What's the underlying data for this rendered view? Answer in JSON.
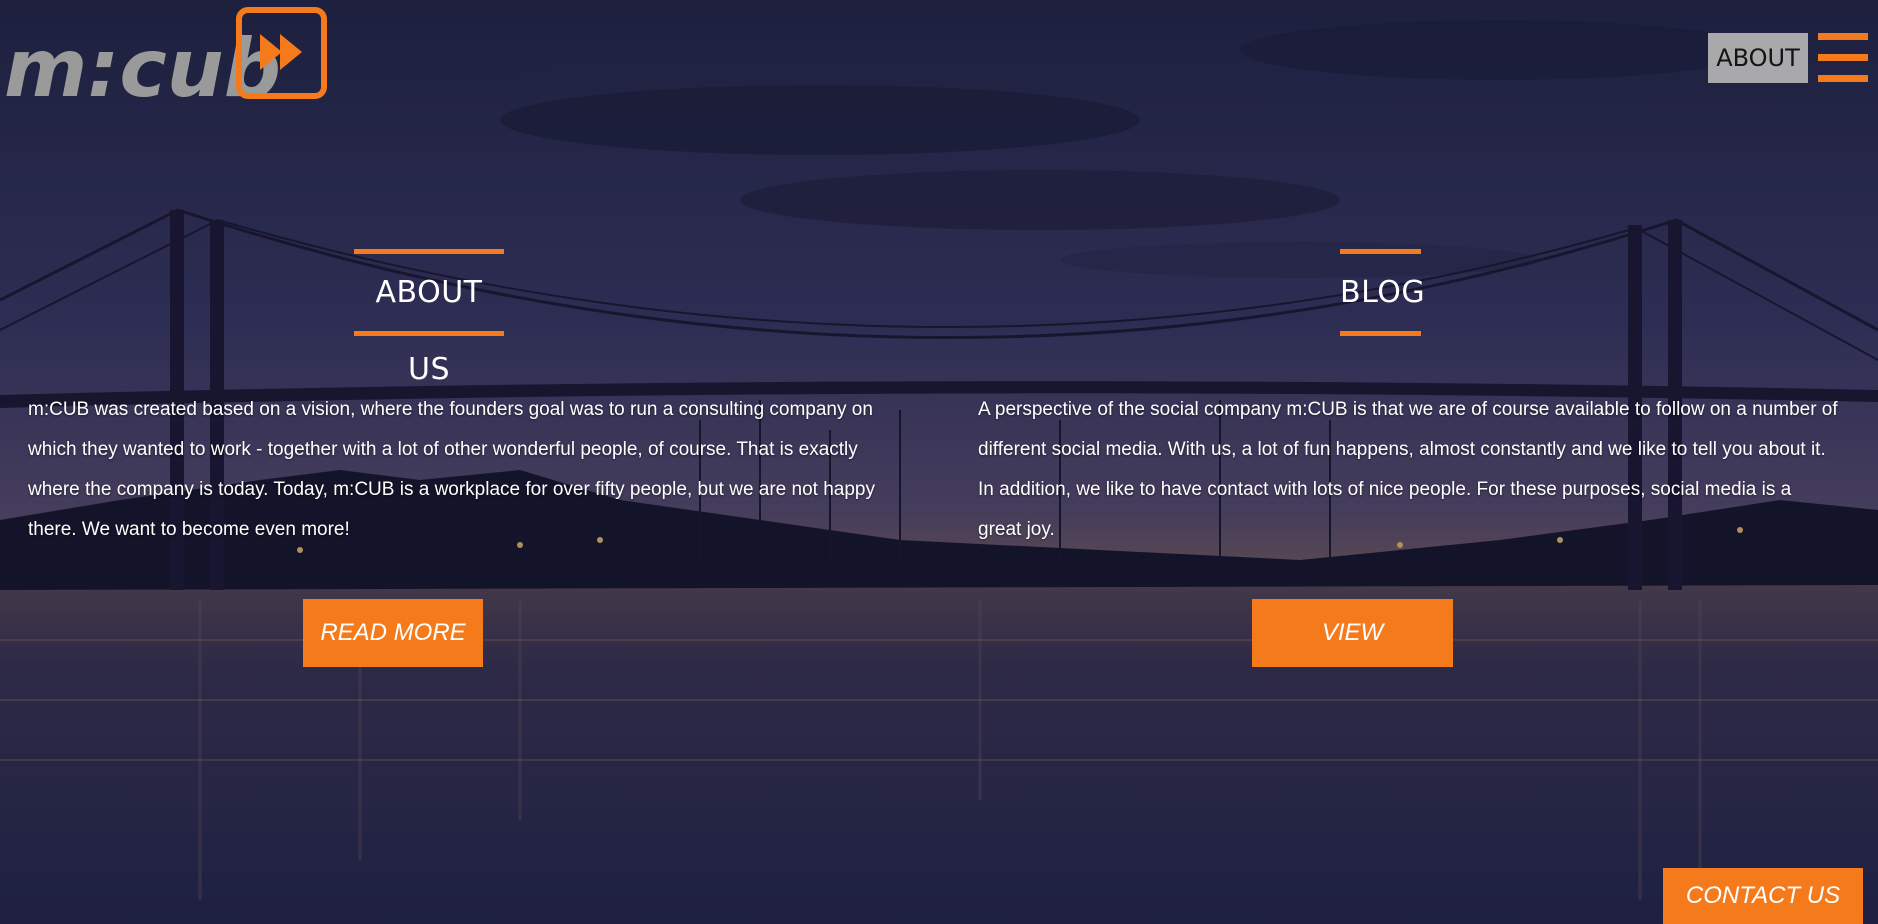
{
  "header": {
    "logo_text": "m:cub",
    "about_label": "ABOUT",
    "menu_icon": "hamburger-menu-icon"
  },
  "about": {
    "title": "ABOUT US",
    "text": "m:CUB was created based on a vision, where the founders goal was to run a consulting company on which they wanted to work - together with a lot of other wonderful people, of course. That is exactly where the company is today. Today, m:CUB is a workplace for over fifty people, but we are not happy there. We want to become even more!",
    "button_label": "READ MORE"
  },
  "blog": {
    "title": "BLOG",
    "text": "A perspective of the social company m:CUB is that we are of course available to follow on a number of different social media. With us, a lot of fun happens, almost constantly and we like to tell you about it. In addition, we like to have contact with lots of nice people. For these purposes, social media is a great joy.",
    "button_label": "VIEW"
  },
  "contact": {
    "label": "CONTACT US"
  },
  "colors": {
    "accent": "#f57a1b",
    "about_bg": "#a9a9ab",
    "logo_grey": "#9a9a9a"
  }
}
